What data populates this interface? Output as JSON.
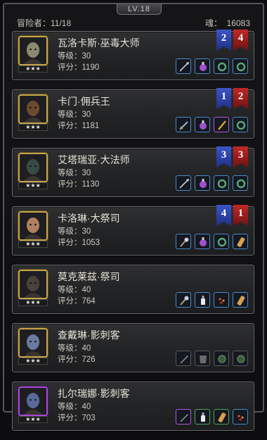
{
  "header": {
    "level_tab": "LV.18",
    "adventurers_label": "冒险者：",
    "adventurers_count": "11/18",
    "soul_label": "魂：",
    "soul_value": "16083"
  },
  "heroes": [
    {
      "name": "瓦洛卡斯·巫毒大师",
      "level": "等级：30",
      "score": "评分：1190",
      "stars": "★★★",
      "rank_blue": "2",
      "rank_red": "4",
      "frame": "gold",
      "slots": [
        {
          "icon": "spear-icon",
          "color": "blue"
        },
        {
          "icon": "potion-icon",
          "color": "blue"
        },
        {
          "icon": "ring-icon",
          "color": "blue"
        },
        {
          "icon": "ring-icon",
          "color": "blue"
        }
      ]
    },
    {
      "name": "卡门·佣兵王",
      "level": "等级：30",
      "score": "评分：1181",
      "stars": "★★★",
      "rank_blue": "1",
      "rank_red": "2",
      "frame": "gold",
      "slots": [
        {
          "icon": "sword-icon",
          "color": "blue"
        },
        {
          "icon": "potion-icon",
          "color": "blue"
        },
        {
          "icon": "rod-icon",
          "color": "purple"
        },
        {
          "icon": "ring-icon",
          "color": "blue"
        }
      ]
    },
    {
      "name": "艾塔瑞亚·大法师",
      "level": "等级：30",
      "score": "评分：1130",
      "stars": "★★★",
      "rank_blue": "3",
      "rank_red": "3",
      "frame": "gold",
      "slots": [
        {
          "icon": "spear-icon",
          "color": "blue"
        },
        {
          "icon": "potion-icon",
          "color": "blue"
        },
        {
          "icon": "ring-icon",
          "color": "blue"
        },
        {
          "icon": "ring-icon",
          "color": "blue"
        }
      ]
    },
    {
      "name": "卡洛琳·大祭司",
      "level": "等级：30",
      "score": "评分：1053",
      "stars": "★★★",
      "rank_blue": "4",
      "rank_red": "1",
      "frame": "gold",
      "slots": [
        {
          "icon": "mace-icon",
          "color": "blue"
        },
        {
          "icon": "potion-icon",
          "color": "blue"
        },
        {
          "icon": "ring-icon",
          "color": "blue"
        },
        {
          "icon": "scroll-icon",
          "color": "blue"
        }
      ]
    },
    {
      "name": "莫克莱兹·祭司",
      "level": "等级：40",
      "score": "评分：764",
      "stars": "★★★",
      "rank_blue": "",
      "rank_red": "",
      "frame": "gold",
      "slots": [
        {
          "icon": "mace-icon",
          "color": "blue"
        },
        {
          "icon": "bottle-icon",
          "color": "blue"
        },
        {
          "icon": "dots-icon",
          "color": "blue"
        },
        {
          "icon": "scroll-icon",
          "color": "blue"
        }
      ]
    },
    {
      "name": "查戴琳·影刺客",
      "level": "等级：40",
      "score": "评分：726",
      "stars": "★★★",
      "rank_blue": "",
      "rank_red": "",
      "frame": "gold",
      "slots": [
        {
          "icon": "blade-icon",
          "color": "gray"
        },
        {
          "icon": "armor-icon",
          "color": "gray"
        },
        {
          "icon": "orb-icon",
          "color": "gray"
        },
        {
          "icon": "orb-icon",
          "color": "gray"
        }
      ]
    },
    {
      "name": "扎尔瑞娜·影刺客",
      "level": "等级：40",
      "score": "评分：703",
      "stars": "★★★",
      "rank_blue": "",
      "rank_red": "",
      "frame": "purple",
      "slots": [
        {
          "icon": "blade-icon",
          "color": "purple"
        },
        {
          "icon": "bottle-icon",
          "color": "green"
        },
        {
          "icon": "scroll-icon",
          "color": "green"
        },
        {
          "icon": "dots-icon",
          "color": "blue"
        }
      ]
    }
  ],
  "colors": {
    "gold_frame": "#c6a54a",
    "purple_frame": "#a848d8",
    "banner_blue": "#2f45b0",
    "banner_red": "#9a1c1c"
  }
}
